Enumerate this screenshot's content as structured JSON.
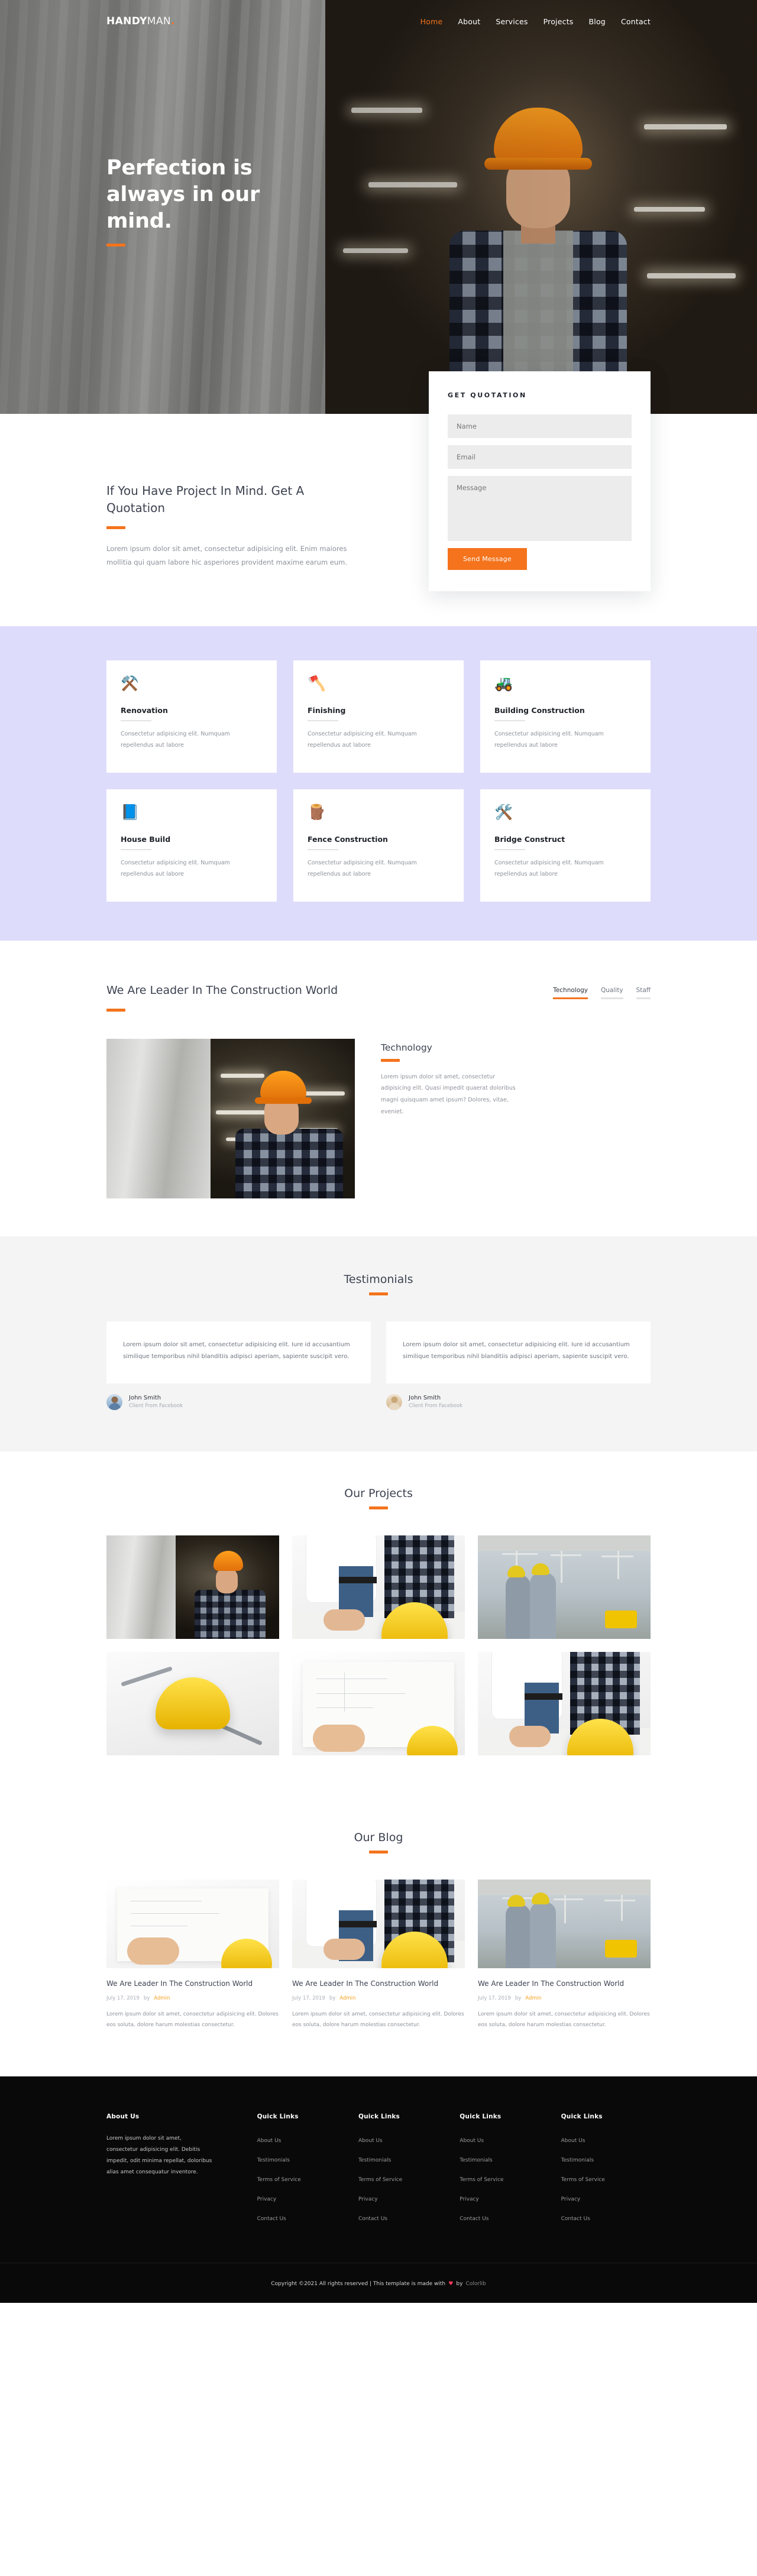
{
  "header": {
    "logo_bold": "HANDY",
    "logo_light": "MAN",
    "logo_dot": ".",
    "nav": [
      {
        "label": "Home",
        "active": true
      },
      {
        "label": "About",
        "active": false
      },
      {
        "label": "Services",
        "active": false
      },
      {
        "label": "Projects",
        "active": false
      },
      {
        "label": "Blog",
        "active": false
      },
      {
        "label": "Contact",
        "active": false
      }
    ]
  },
  "hero": {
    "heading_line1": "Perfection is",
    "heading_line2": "always in our",
    "heading_line3": "mind."
  },
  "quotation": {
    "form_title": "GET QUOTATION",
    "name_placeholder": "Name",
    "email_placeholder": "Email",
    "message_placeholder": "Message",
    "submit_label": "Send Message",
    "name_value": "",
    "email_value": "",
    "message_value": "",
    "left_heading": "If You Have Project In Mind. Get A Quotation",
    "left_text": "Lorem ipsum dolor sit amet, consectetur adipisicing elit. Enim maiores mollitia qui quam labore hic asperiores provident maxime earum eum."
  },
  "services": {
    "cards": [
      {
        "icon": "⚒️",
        "title": "Renovation",
        "text": "Consectetur adipisicing elit. Numquam repellendus aut labore"
      },
      {
        "icon": "🪓",
        "title": "Finishing",
        "text": "Consectetur adipisicing elit. Numquam repellendus aut labore"
      },
      {
        "icon": "🚜",
        "title": "Building Construction",
        "text": "Consectetur adipisicing elit. Numquam repellendus aut labore"
      },
      {
        "icon": "📘",
        "title": "House Build",
        "text": "Consectetur adipisicing elit. Numquam repellendus aut labore"
      },
      {
        "icon": "🪵",
        "title": "Fence Construction",
        "text": "Consectetur adipisicing elit. Numquam repellendus aut labore"
      },
      {
        "icon": "🛠️",
        "title": "Bridge Construct",
        "text": "Consectetur adipisicing elit. Numquam repellendus aut labore"
      }
    ]
  },
  "leader": {
    "heading": "We Are Leader In The Construction World",
    "tabs": [
      {
        "label": "Technology",
        "active": true
      },
      {
        "label": "Quality",
        "active": false
      },
      {
        "label": "Staff",
        "active": false
      }
    ],
    "panel_title": "Technology",
    "panel_text": "Lorem ipsum dolor sit amet, consectetur adipisicing elit. Quasi impedit quaerat doloribus magni quisquam amet ipsum? Dolores, vitae, eveniet."
  },
  "testimonials": {
    "heading": "Testimonials",
    "items": [
      {
        "quote": "Lorem ipsum dolor sit amet, consectetur adipisicing elit. Iure id accusantium similique temporibus nihil blanditiis adipisci aperiam, sapiente suscipit vero.",
        "name": "John Smith",
        "role": "Client From Facebook",
        "avatar": "male"
      },
      {
        "quote": "Lorem ipsum dolor sit amet, consectetur adipisicing elit. Iure id accusantium similique temporibus nihil blanditiis adipisci aperiam, sapiente suscipit vero.",
        "name": "John Smith",
        "role": "Client From Facebook",
        "avatar": "female"
      }
    ]
  },
  "projects": {
    "heading": "Our Projects",
    "items": [
      {
        "alt": "worker-with-orange-helmet"
      },
      {
        "alt": "hands-on-blueprint-with-yellow-helmet"
      },
      {
        "alt": "two-workers-facing-construction-site"
      },
      {
        "alt": "yellow-helmet-with-tools"
      },
      {
        "alt": "hands-drawing-plan"
      },
      {
        "alt": "yellow-helmet-on-blueprint"
      }
    ]
  },
  "blog": {
    "heading": "Our Blog",
    "posts": [
      {
        "title": "We Are Leader In The Construction World",
        "date": "July 17, 2019",
        "by": "by",
        "author": "Admin",
        "excerpt": "Lorem ipsum dolor sit amet, consectetur adipisicing elit. Dolores eos soluta, dolore harum molestias consectetur.",
        "thumb": "drawing"
      },
      {
        "title": "We Are Leader In The Construction World",
        "date": "July 17, 2019",
        "by": "by",
        "author": "Admin",
        "excerpt": "Lorem ipsum dolor sit amet, consectetur adipisicing elit. Dolores eos soluta, dolore harum molestias consectetur.",
        "thumb": "plan"
      },
      {
        "title": "We Are Leader In The Construction World",
        "date": "July 17, 2019",
        "by": "by",
        "author": "Admin",
        "excerpt": "Lorem ipsum dolor sit amet, consectetur adipisicing elit. Dolores eos soluta, dolore harum molestias consectetur.",
        "thumb": "site"
      }
    ]
  },
  "footer": {
    "about_title": "About Us",
    "about_text": "Lorem ipsum dolor sit amet, consectetur adipisicing elit. Debitis impedit, odit minima repellat, doloribus alias amet consequatur inventore.",
    "columns": [
      {
        "title": "Quick Links",
        "links": [
          "About Us",
          "Testimonials",
          "Terms of Service",
          "Privacy",
          "Contact Us"
        ]
      },
      {
        "title": "Quick Links",
        "links": [
          "About Us",
          "Testimonials",
          "Terms of Service",
          "Privacy",
          "Contact Us"
        ]
      },
      {
        "title": "Quick Links",
        "links": [
          "About Us",
          "Testimonials",
          "Terms of Service",
          "Privacy",
          "Contact Us"
        ]
      },
      {
        "title": "Quick Links",
        "links": [
          "About Us",
          "Testimonials",
          "Terms of Service",
          "Privacy",
          "Contact Us"
        ]
      }
    ],
    "copyright_before": "Copyright ©2021 All rights reserved | This template is made with",
    "heart": "♥",
    "copyright_mid": "by",
    "brand": "Colorlib"
  },
  "colors": {
    "accent": "#f4731c",
    "services_bg": "#dedcfb",
    "testimonials_bg": "#f4f4f4",
    "footer_bg": "#090909",
    "heart": "#ff3b5c"
  }
}
